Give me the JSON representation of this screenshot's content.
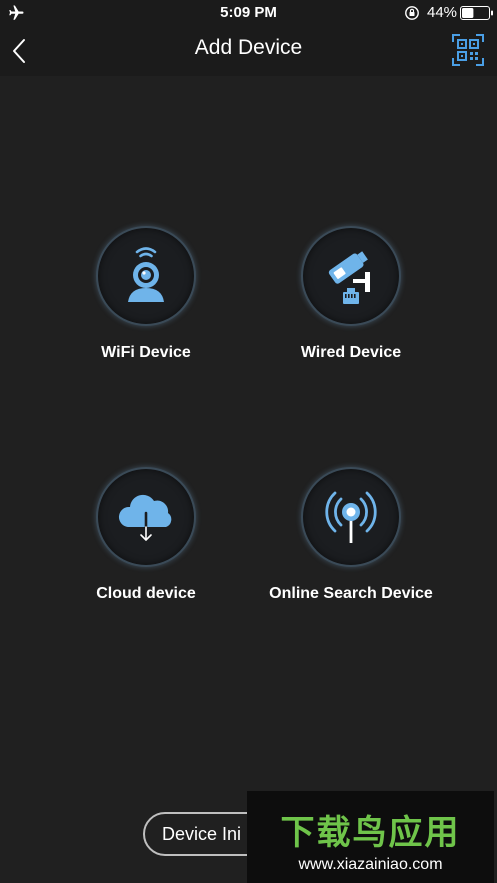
{
  "status_bar": {
    "time": "5:09 PM",
    "battery": "44%",
    "battery_level": 0.44
  },
  "nav": {
    "title": "Add Device"
  },
  "tiles": [
    {
      "label": "WiFi Device",
      "icon": "wifi-camera-icon"
    },
    {
      "label": "Wired Device",
      "icon": "wired-camera-icon"
    },
    {
      "label": "Cloud device",
      "icon": "cloud-download-icon"
    },
    {
      "label": "Online Search Device",
      "icon": "broadcast-signal-icon"
    }
  ],
  "bottom_button": {
    "label": "Device Ini"
  },
  "watermark": {
    "title": "下载鸟应用",
    "url": "www.xiazainiao.com"
  },
  "colors": {
    "background": "#202020",
    "icon_blue": "#6fb4ea",
    "watermark_green": "#6fc44a"
  }
}
